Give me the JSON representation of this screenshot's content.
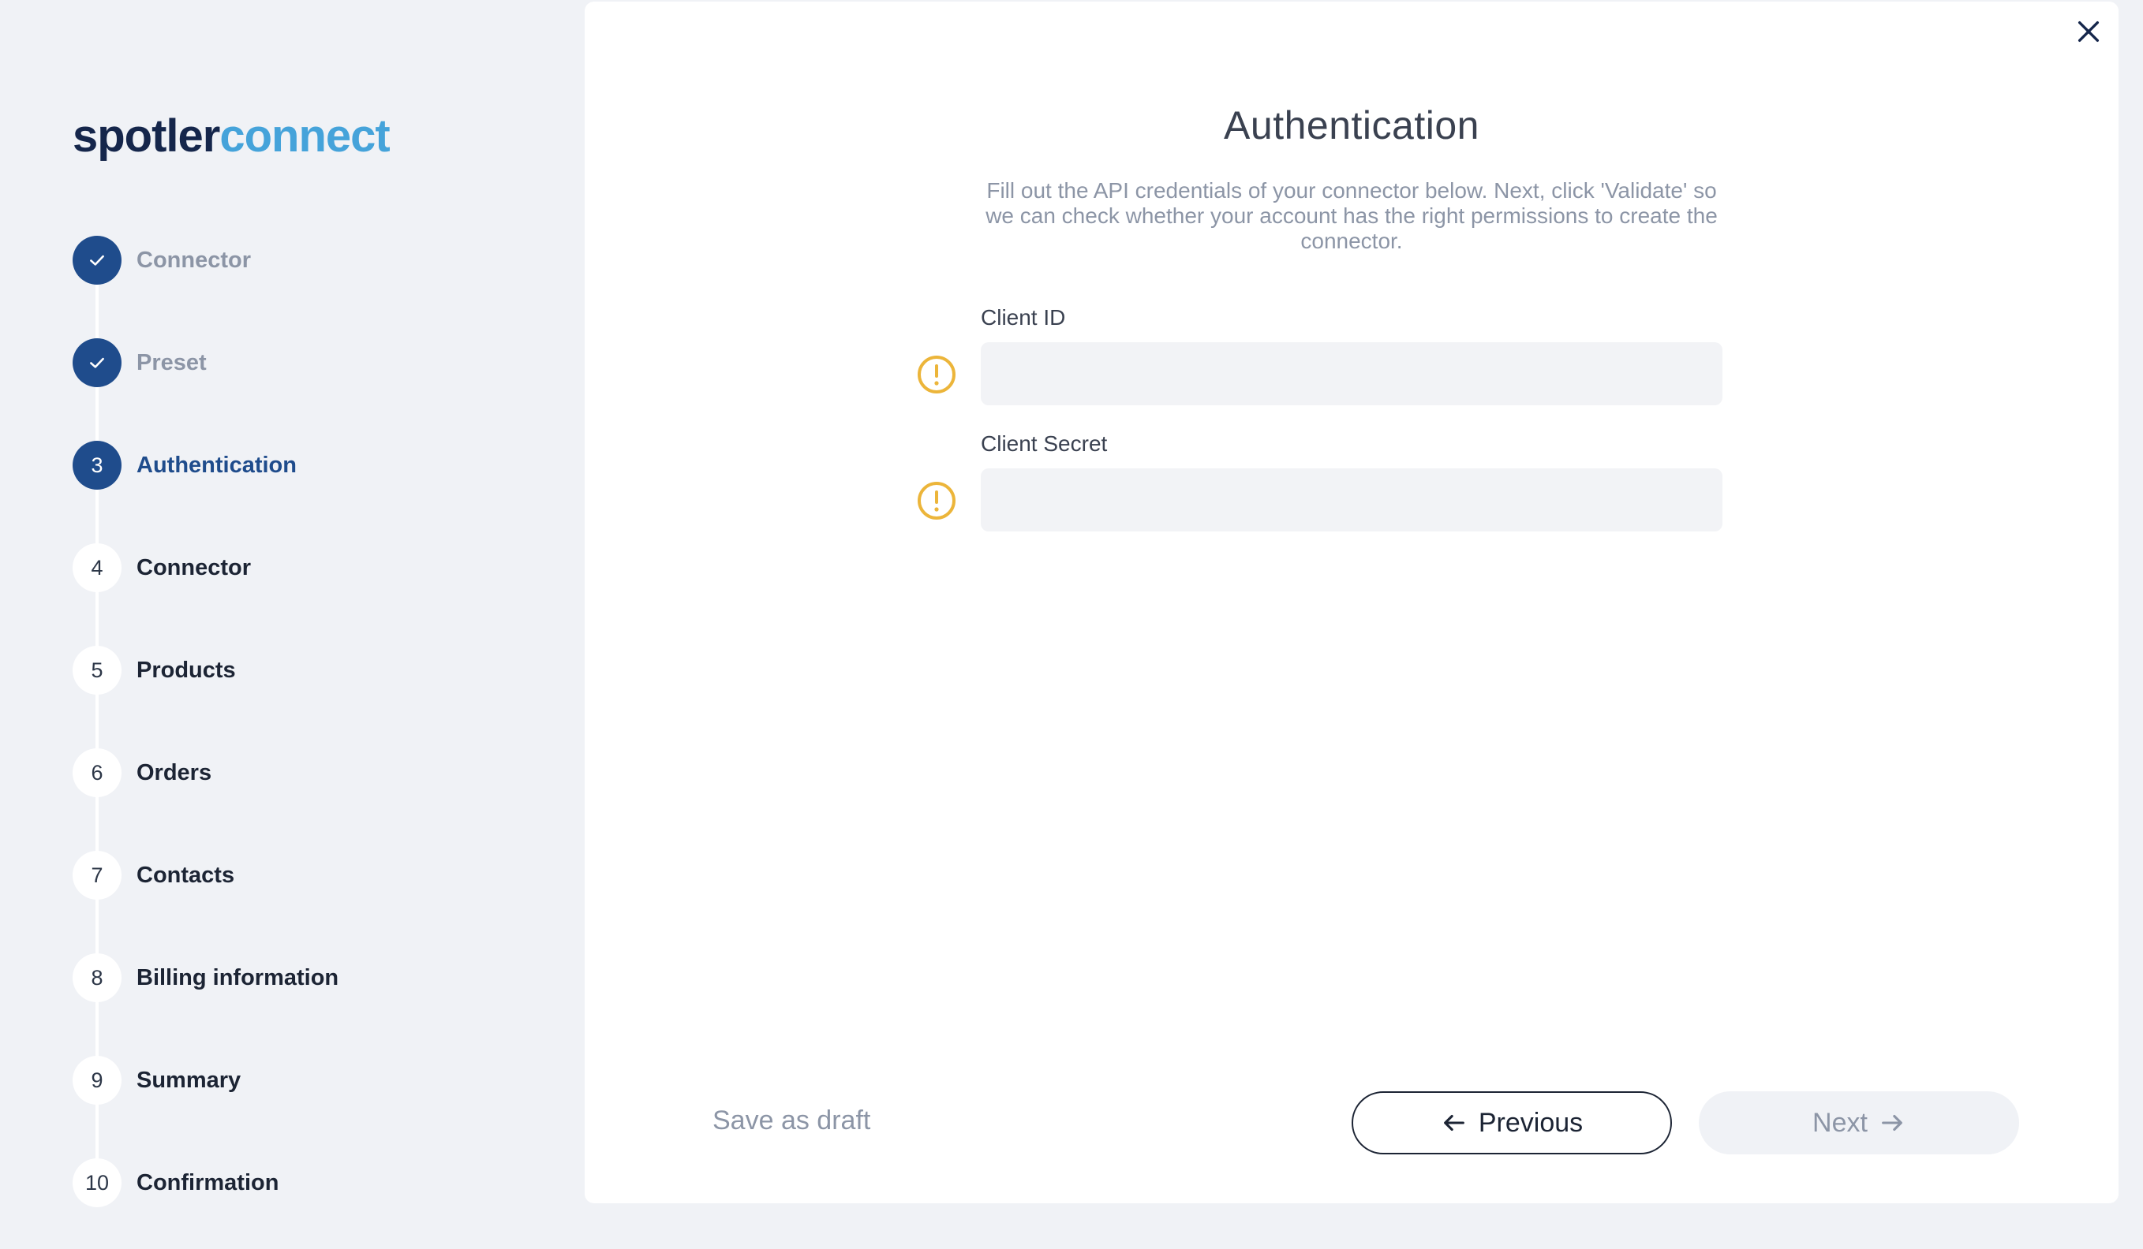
{
  "logo": {
    "part1": "spotler",
    "part2": "connect"
  },
  "steps": [
    {
      "number": "1",
      "label": "Connector",
      "status": "done"
    },
    {
      "number": "2",
      "label": "Preset",
      "status": "done"
    },
    {
      "number": "3",
      "label": "Authentication",
      "status": "active"
    },
    {
      "number": "4",
      "label": "Connector",
      "status": "todo"
    },
    {
      "number": "5",
      "label": "Products",
      "status": "todo"
    },
    {
      "number": "6",
      "label": "Orders",
      "status": "todo"
    },
    {
      "number": "7",
      "label": "Contacts",
      "status": "todo"
    },
    {
      "number": "8",
      "label": "Billing information",
      "status": "todo"
    },
    {
      "number": "9",
      "label": "Summary",
      "status": "todo"
    },
    {
      "number": "10",
      "label": "Confirmation",
      "status": "todo"
    }
  ],
  "main": {
    "title": "Authentication",
    "description": "Fill out the API credentials of your connector below. Next, click 'Validate' so we can check whether your account has the right permissions to create the connector.",
    "fields": [
      {
        "label": "Client ID",
        "value": ""
      },
      {
        "label": "Client Secret",
        "value": ""
      }
    ]
  },
  "footer": {
    "save_draft": "Save as draft",
    "previous": "Previous",
    "next": "Next"
  },
  "colors": {
    "primary": "#1f4c8c",
    "logo_dark": "#15264b",
    "logo_light": "#45a3da",
    "warning": "#ecb53a",
    "muted": "#8c95a6"
  }
}
